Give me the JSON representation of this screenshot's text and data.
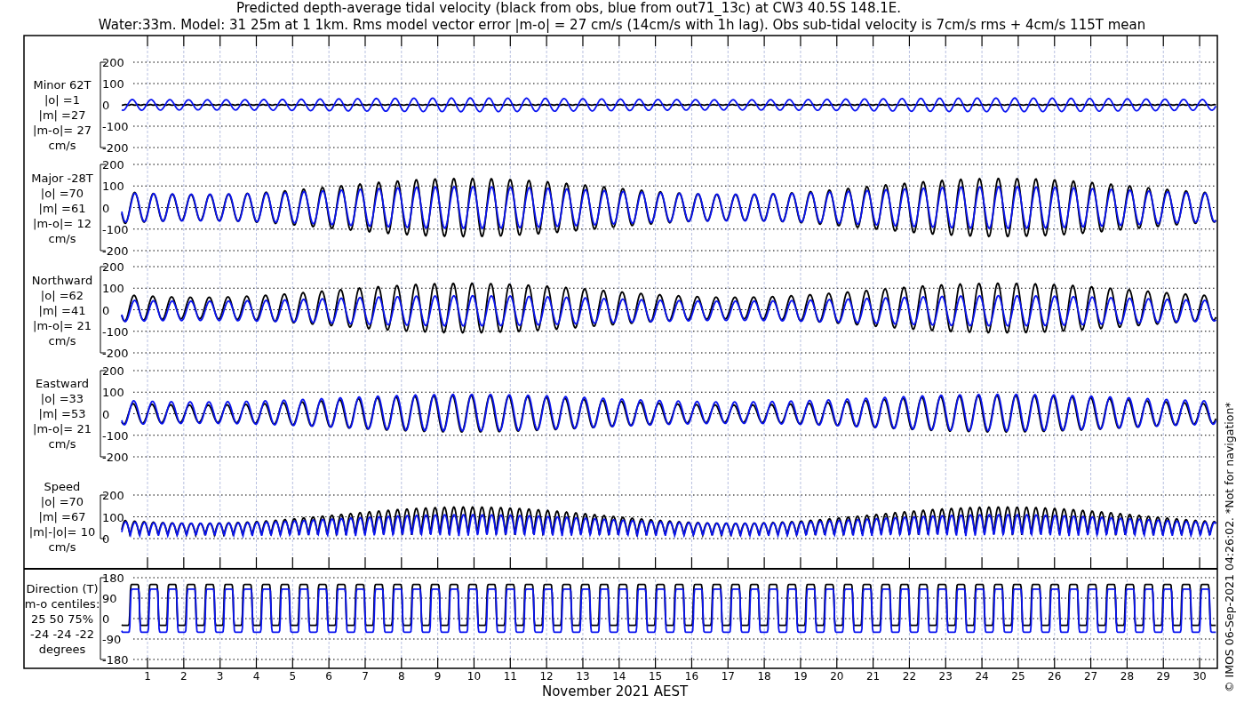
{
  "title_lines": [
    "Predicted depth-average tidal velocity (black from obs, blue from out71_13c) at CW3 40.5S 148.1E.",
    "Water:33m. Model: 31 25m at 1 1km. Rms model vector error |m-o| = 27 cm/s (14cm/s with 1h lag). Obs sub-tidal velocity is 7cm/s rms + 4cm/s 115T mean"
  ],
  "panels": [
    {
      "kind": "minor",
      "label_lines": [
        "Minor 62T",
        "|o| =1",
        "|m| =27",
        "|m-o|= 27",
        "cm/s"
      ],
      "yticks": [
        "200",
        "100",
        "0",
        "-100",
        "-200"
      ]
    },
    {
      "kind": "major",
      "label_lines": [
        "Major -28T",
        "|o| =70",
        "|m| =61",
        "|m-o|= 12",
        "cm/s"
      ],
      "yticks": [
        "200",
        "100",
        "0",
        "-100",
        "-200"
      ]
    },
    {
      "kind": "north",
      "label_lines": [
        "Northward",
        "|o| =62",
        "|m| =41",
        "|m-o|= 21",
        "cm/s"
      ],
      "yticks": [
        "200",
        "100",
        "0",
        "-100",
        "-200"
      ]
    },
    {
      "kind": "east",
      "label_lines": [
        "Eastward",
        "|o| =33",
        "|m| =53",
        "|m-o|= 21",
        "cm/s"
      ],
      "yticks": [
        "200",
        "100",
        "0",
        "-100",
        "-200"
      ]
    },
    {
      "kind": "speed",
      "label_lines": [
        "Speed",
        "|o| =70",
        "|m| =67",
        "|m|-|o|= 10",
        "cm/s"
      ],
      "yticks": [
        "200",
        "100",
        "0"
      ]
    },
    {
      "kind": "direction",
      "label_lines": [
        "Direction (T)",
        "m-o centiles:",
        "25  50  75%",
        "-24 -24 -22",
        "degrees"
      ],
      "yticks": [
        "180",
        "90",
        "0",
        "-90",
        "-180"
      ]
    }
  ],
  "xticks": [
    "1",
    "2",
    "3",
    "4",
    "5",
    "6",
    "7",
    "8",
    "9",
    "10",
    "11",
    "12",
    "13",
    "14",
    "15",
    "16",
    "17",
    "18",
    "19",
    "20",
    "21",
    "22",
    "23",
    "24",
    "25",
    "26",
    "27",
    "28",
    "29",
    "30"
  ],
  "xlabel": "November 2021 AEST",
  "credit": "© IMOS 06-Sep-2021 04:26:02. *Not for navigation*"
}
